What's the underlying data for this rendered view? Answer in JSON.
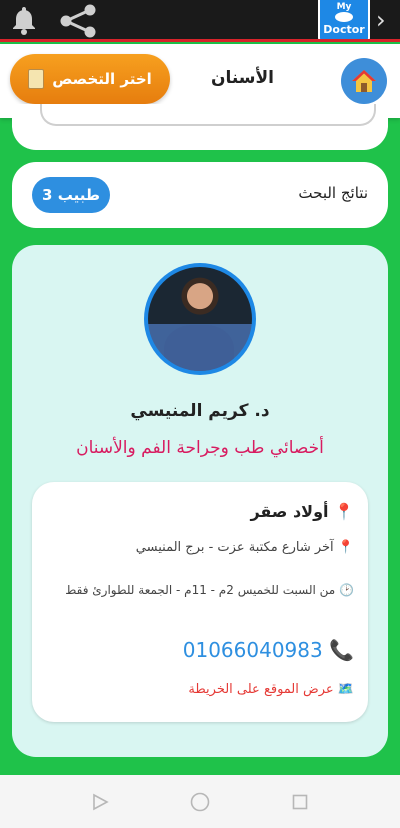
{
  "status_bar": {
    "app_badge_top": "My",
    "app_badge_bottom": "Doctor"
  },
  "header": {
    "title": "الأسنان",
    "choose_button_label": "اختر التخصص"
  },
  "results": {
    "label": "نتائج البحث",
    "count_label": "3 طبيب"
  },
  "doctor": {
    "name": "د. كريم المنيسي",
    "specialty": "أخصائي طب وجراحة الفم والأسنان",
    "location": "أولاد صقر",
    "address": "آخر شارع مكتبة عزت - برج المنيسي",
    "hours": "من السبت للخميس 2م - 11م - الجمعة للطوارئ فقط",
    "phone": "01066040983",
    "map_link": "عرض الموقع على الخريطة"
  },
  "colors": {
    "background": "#1fc24a",
    "accent_orange": "#f7a01f",
    "accent_blue": "#2e8fe0",
    "specialty_pink": "#d81b60",
    "map_red": "#e53935"
  },
  "icons": [
    "bell-icon",
    "share-icon",
    "chevron-right-icon",
    "clipboard-icon",
    "home-icon",
    "pin-icon",
    "clock-icon",
    "phone-icon",
    "map-icon",
    "back-triangle-icon",
    "home-circle-icon",
    "recents-square-icon"
  ]
}
